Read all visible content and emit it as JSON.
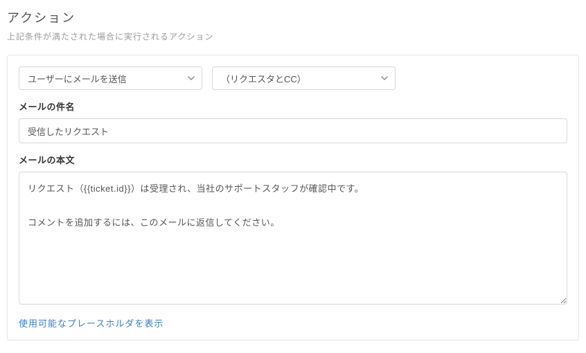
{
  "header": {
    "title": "アクション",
    "subtitle": "上記条件が満たされた場合に実行されるアクション"
  },
  "action": {
    "type_select": {
      "selected": "ユーザーにメールを送信"
    },
    "target_select": {
      "selected": "（リクエスタとCC）"
    }
  },
  "subject": {
    "label": "メールの件名",
    "value": "受信したリクエスト"
  },
  "body": {
    "label": "メールの本文",
    "value": "リクエスト（{{ticket.id}}）は受理され、当社のサポートスタッフが確認中です。\n\nコメントを追加するには、このメールに返信してください。"
  },
  "placeholder_link": "使用可能なプレースホルダを表示"
}
